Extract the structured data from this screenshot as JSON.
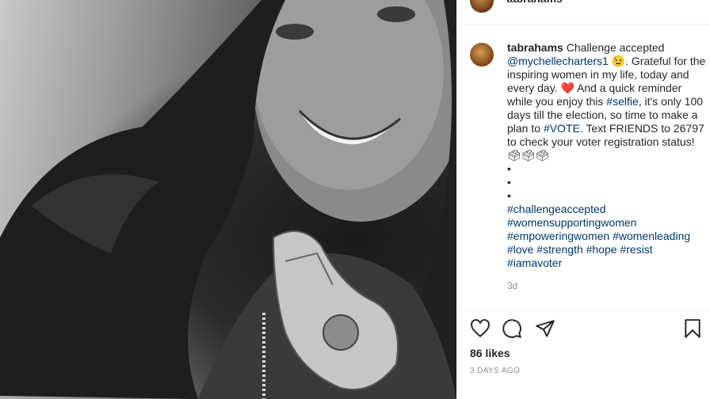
{
  "post": {
    "username": "tabrahams",
    "photo_alt": "",
    "caption": {
      "part1": " Challenge accepted ",
      "mention": "@mychellecharters1",
      "emoji_wink": "😉",
      "part2": ". Grateful for the inspiring women in my life, today and every day. ",
      "emoji_heart": "❤️",
      "part3": " And a quick reminder while you enjoy this ",
      "tag_selfie": "#selfie",
      "part4": ", it's only 100 days till the election, so time to make a plan to ",
      "tag_vote": "#VOTE",
      "part5": ". Text FRIENDS to 26797 to check your voter registration status! ",
      "emoji_ballots": "🗳🗳🗳",
      "dots": [
        "•",
        "•",
        "•"
      ],
      "hashtags": [
        "#challengeaccepted",
        "#womensupportingwomen",
        "#empoweringwomen",
        "#womenleading",
        "#love",
        "#strength",
        "#hope",
        "#resist",
        "#iamavoter"
      ],
      "age": "3d"
    },
    "likes": "86 likes",
    "posted": "3 DAYS AGO"
  }
}
